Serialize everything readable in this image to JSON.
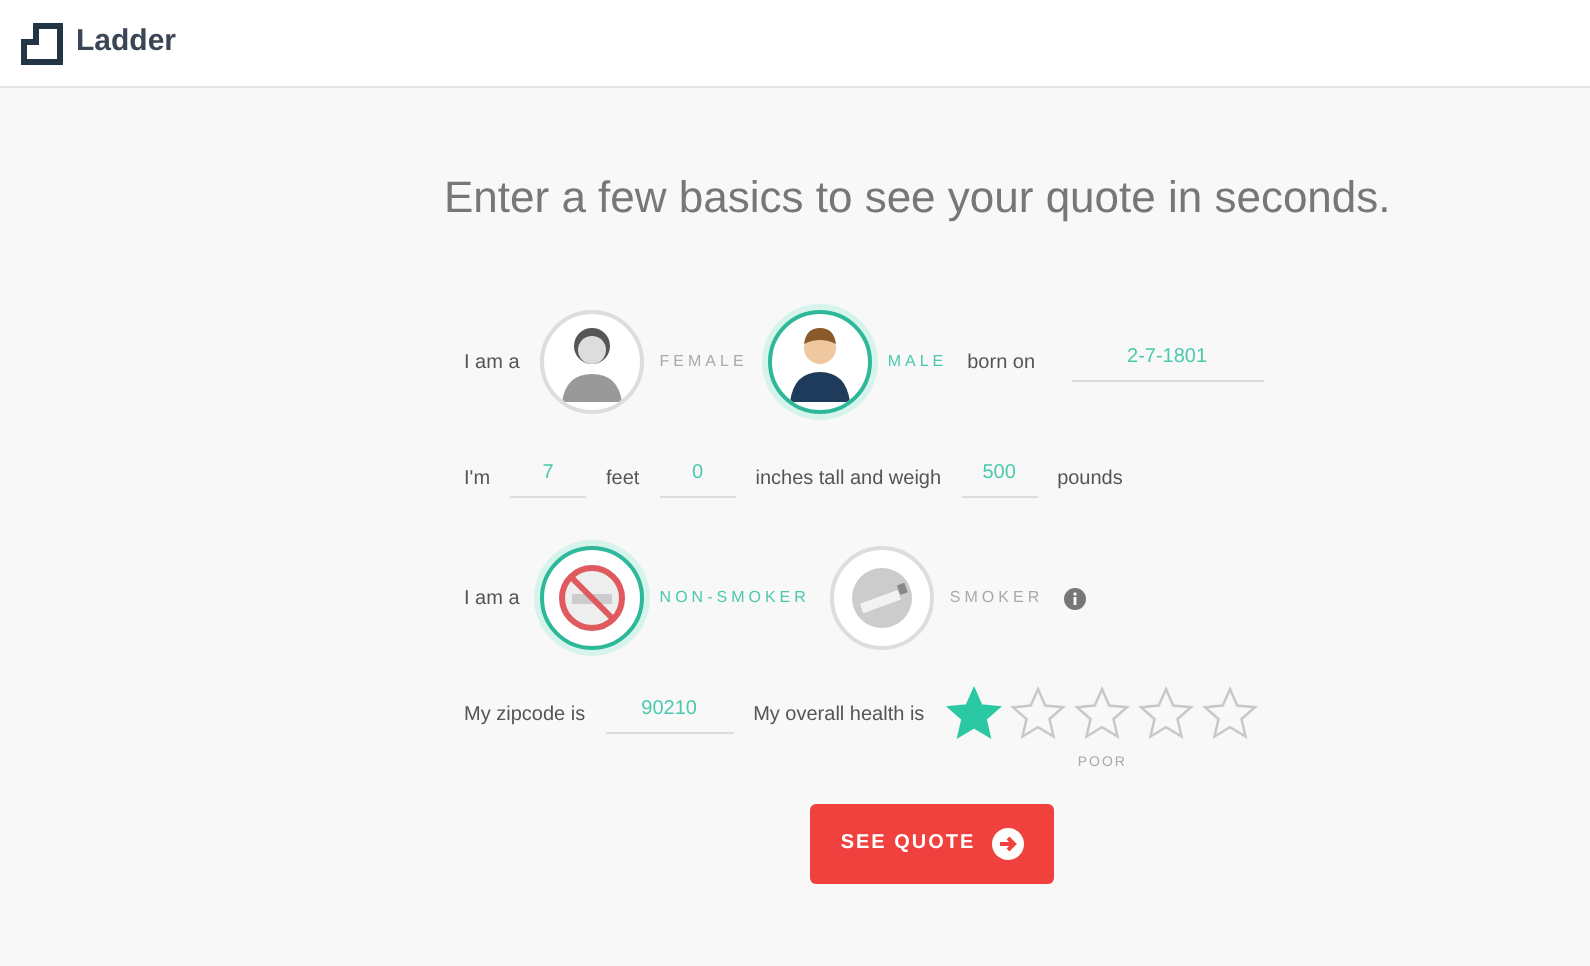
{
  "header": {
    "logo_text": "Ladder"
  },
  "heading": "Enter a few basics to see your quote in seconds.",
  "gender_row": {
    "prefix": "I am a",
    "options": [
      {
        "kind": "female",
        "label": "FEMALE",
        "selected": false
      },
      {
        "kind": "male",
        "label": "MALE",
        "selected": true
      }
    ],
    "born_label": "born on",
    "birthdate": "2-7-1801"
  },
  "size_row": [
    {
      "kind": "text",
      "text": "I'm"
    },
    {
      "kind": "field",
      "value": "7"
    },
    {
      "kind": "text",
      "text": "feet"
    },
    {
      "kind": "field",
      "value": "0"
    },
    {
      "kind": "text",
      "text": "inches tall and weigh"
    },
    {
      "kind": "field",
      "value": "500"
    },
    {
      "kind": "text",
      "text": "pounds"
    }
  ],
  "smoker_row": {
    "prefix": "I am a",
    "options": [
      {
        "kind": "non-smoker",
        "label": "NON-SMOKER",
        "selected": true
      },
      {
        "kind": "smoker",
        "label": "SMOKER",
        "selected": false
      }
    ]
  },
  "health_row": {
    "zip_label": "My zipcode is",
    "zipcode": "90210",
    "health_label": "My overall health is",
    "stars": 1,
    "star_caption": "POOR"
  },
  "button": "SEE QUOTE"
}
